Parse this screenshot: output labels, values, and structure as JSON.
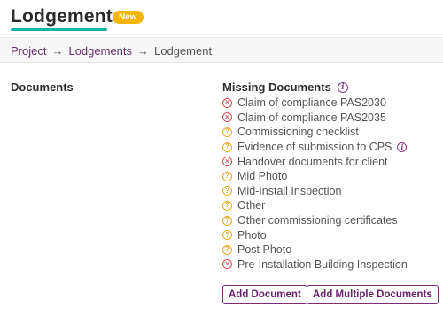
{
  "header": {
    "title": "Lodgement",
    "badge": "New"
  },
  "breadcrumb": {
    "items": [
      "Project",
      "Lodgements"
    ],
    "separator": "→",
    "current": "Lodgement"
  },
  "documents": {
    "section_label": "Documents",
    "missing_heading": "Missing Documents",
    "items": [
      {
        "label": "Claim of compliance PAS2030",
        "status": "missing-required",
        "icon": "x-circle-icon"
      },
      {
        "label": "Claim of compliance PAS2035",
        "status": "missing-required",
        "icon": "x-circle-icon"
      },
      {
        "label": "Commissioning checklist",
        "status": "optional",
        "icon": "question-circle-icon"
      },
      {
        "label": "Evidence of submission to CPS",
        "status": "optional",
        "icon": "question-circle-icon",
        "info": true
      },
      {
        "label": "Handover documents for client",
        "status": "missing-required",
        "icon": "x-circle-icon"
      },
      {
        "label": "Mid Photo",
        "status": "optional",
        "icon": "question-circle-icon"
      },
      {
        "label": "Mid-Install Inspection",
        "status": "optional",
        "icon": "question-circle-icon"
      },
      {
        "label": "Other",
        "status": "optional",
        "icon": "question-circle-icon"
      },
      {
        "label": "Other commissioning certificates",
        "status": "optional",
        "icon": "question-circle-icon"
      },
      {
        "label": "Photo",
        "status": "optional",
        "icon": "question-circle-icon"
      },
      {
        "label": "Post Photo",
        "status": "optional",
        "icon": "question-circle-icon"
      },
      {
        "label": "Pre-Installation Building Inspection",
        "status": "missing-required",
        "icon": "x-circle-icon"
      }
    ],
    "add_document_label": "Add Document",
    "add_multiple_label": "Add Multiple Documents"
  },
  "colors": {
    "accent": "#6b2170",
    "underline": "#16b3a8",
    "badge": "#f5b400",
    "missing": "#e0474c",
    "optional": "#f0a820"
  }
}
